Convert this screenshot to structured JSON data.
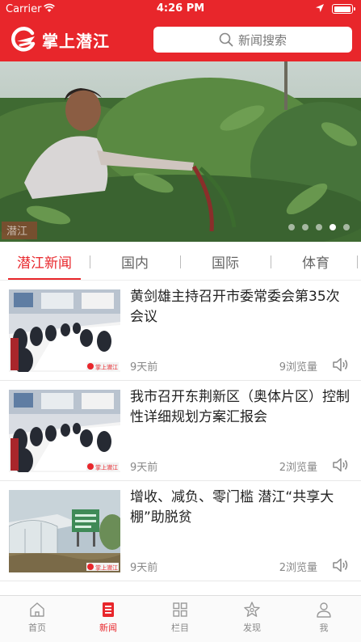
{
  "status_bar": {
    "carrier": "Carrier",
    "time": "4:26 PM"
  },
  "header": {
    "app_title": "掌上潜江",
    "search_placeholder": "新闻搜索"
  },
  "banner": {
    "watermark": "潜江",
    "dot_count": 5,
    "active_dot": 3
  },
  "tabs": [
    {
      "label": "潜江新闻",
      "active": true
    },
    {
      "label": "国内",
      "active": false
    },
    {
      "label": "国际",
      "active": false
    },
    {
      "label": "体育",
      "active": false
    }
  ],
  "news": [
    {
      "title": "黄剑雄主持召开市委常委会第35次会议",
      "time": "9天前",
      "views": "9浏览量",
      "thumb": "meeting",
      "thumb_logo": "掌上潜江"
    },
    {
      "title": "我市召开东荆新区（奥体片区）控制性详细规划方案汇报会",
      "time": "9天前",
      "views": "2浏览量",
      "thumb": "meeting",
      "thumb_logo": "掌上潜江"
    },
    {
      "title": "增收、减负、零门槛 潜江“共享大棚”助脱贫",
      "time": "9天前",
      "views": "2浏览量",
      "thumb": "greenhouse",
      "thumb_logo": "掌上潜江"
    }
  ],
  "tabbar": [
    {
      "label": "首页",
      "icon": "home-icon",
      "active": false
    },
    {
      "label": "新闻",
      "icon": "news-icon",
      "active": true
    },
    {
      "label": "栏目",
      "icon": "grid-icon",
      "active": false
    },
    {
      "label": "发现",
      "icon": "discover-icon",
      "active": false
    },
    {
      "label": "我",
      "icon": "user-icon",
      "active": false
    }
  ],
  "colors": {
    "brand_red": "#e8262b",
    "text": "#222222",
    "muted": "#888888"
  }
}
